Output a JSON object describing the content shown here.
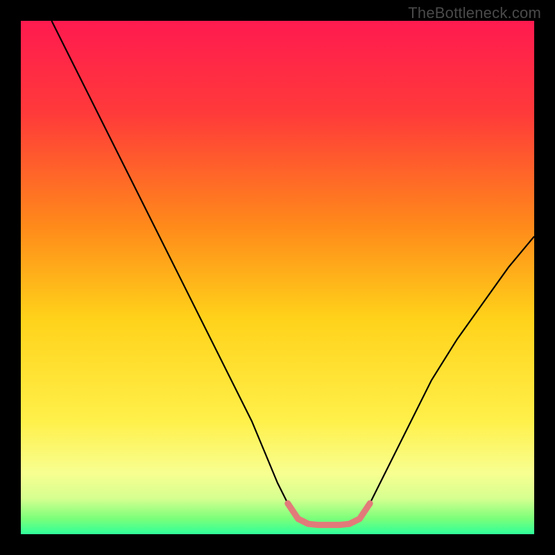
{
  "watermark": "TheBottleneck.com",
  "chart_data": {
    "type": "line",
    "title": "",
    "xlabel": "",
    "ylabel": "",
    "xlim": [
      0,
      100
    ],
    "ylim": [
      0,
      100
    ],
    "grid": false,
    "legend": null,
    "gradient_stops": [
      {
        "offset": 0.0,
        "color": "#ff1a4f"
      },
      {
        "offset": 0.18,
        "color": "#ff3a3a"
      },
      {
        "offset": 0.4,
        "color": "#ff8a1a"
      },
      {
        "offset": 0.58,
        "color": "#ffd21a"
      },
      {
        "offset": 0.78,
        "color": "#fff04a"
      },
      {
        "offset": 0.88,
        "color": "#f8ff90"
      },
      {
        "offset": 0.93,
        "color": "#d6ff90"
      },
      {
        "offset": 0.97,
        "color": "#7aff7a"
      },
      {
        "offset": 1.0,
        "color": "#2fff9a"
      }
    ],
    "series": [
      {
        "name": "bottleneck-curve",
        "color": "#000000",
        "stroke_width": 2.2,
        "points": [
          {
            "x": 6,
            "y": 100
          },
          {
            "x": 10,
            "y": 92
          },
          {
            "x": 15,
            "y": 82
          },
          {
            "x": 20,
            "y": 72
          },
          {
            "x": 25,
            "y": 62
          },
          {
            "x": 30,
            "y": 52
          },
          {
            "x": 35,
            "y": 42
          },
          {
            "x": 40,
            "y": 32
          },
          {
            "x": 45,
            "y": 22
          },
          {
            "x": 50,
            "y": 10
          },
          {
            "x": 53,
            "y": 4
          },
          {
            "x": 55,
            "y": 2
          },
          {
            "x": 58,
            "y": 1.5
          },
          {
            "x": 62,
            "y": 1.5
          },
          {
            "x": 65,
            "y": 2
          },
          {
            "x": 67,
            "y": 4
          },
          {
            "x": 70,
            "y": 10
          },
          {
            "x": 75,
            "y": 20
          },
          {
            "x": 80,
            "y": 30
          },
          {
            "x": 85,
            "y": 38
          },
          {
            "x": 90,
            "y": 45
          },
          {
            "x": 95,
            "y": 52
          },
          {
            "x": 100,
            "y": 58
          }
        ]
      },
      {
        "name": "optimal-zone-marker",
        "color": "#e27a7a",
        "stroke_width": 9,
        "linecap": "round",
        "points": [
          {
            "x": 52,
            "y": 6
          },
          {
            "x": 54,
            "y": 3
          },
          {
            "x": 56,
            "y": 2
          },
          {
            "x": 58,
            "y": 1.8
          },
          {
            "x": 60,
            "y": 1.8
          },
          {
            "x": 62,
            "y": 1.8
          },
          {
            "x": 64,
            "y": 2
          },
          {
            "x": 66,
            "y": 3
          },
          {
            "x": 68,
            "y": 6
          }
        ]
      }
    ]
  }
}
